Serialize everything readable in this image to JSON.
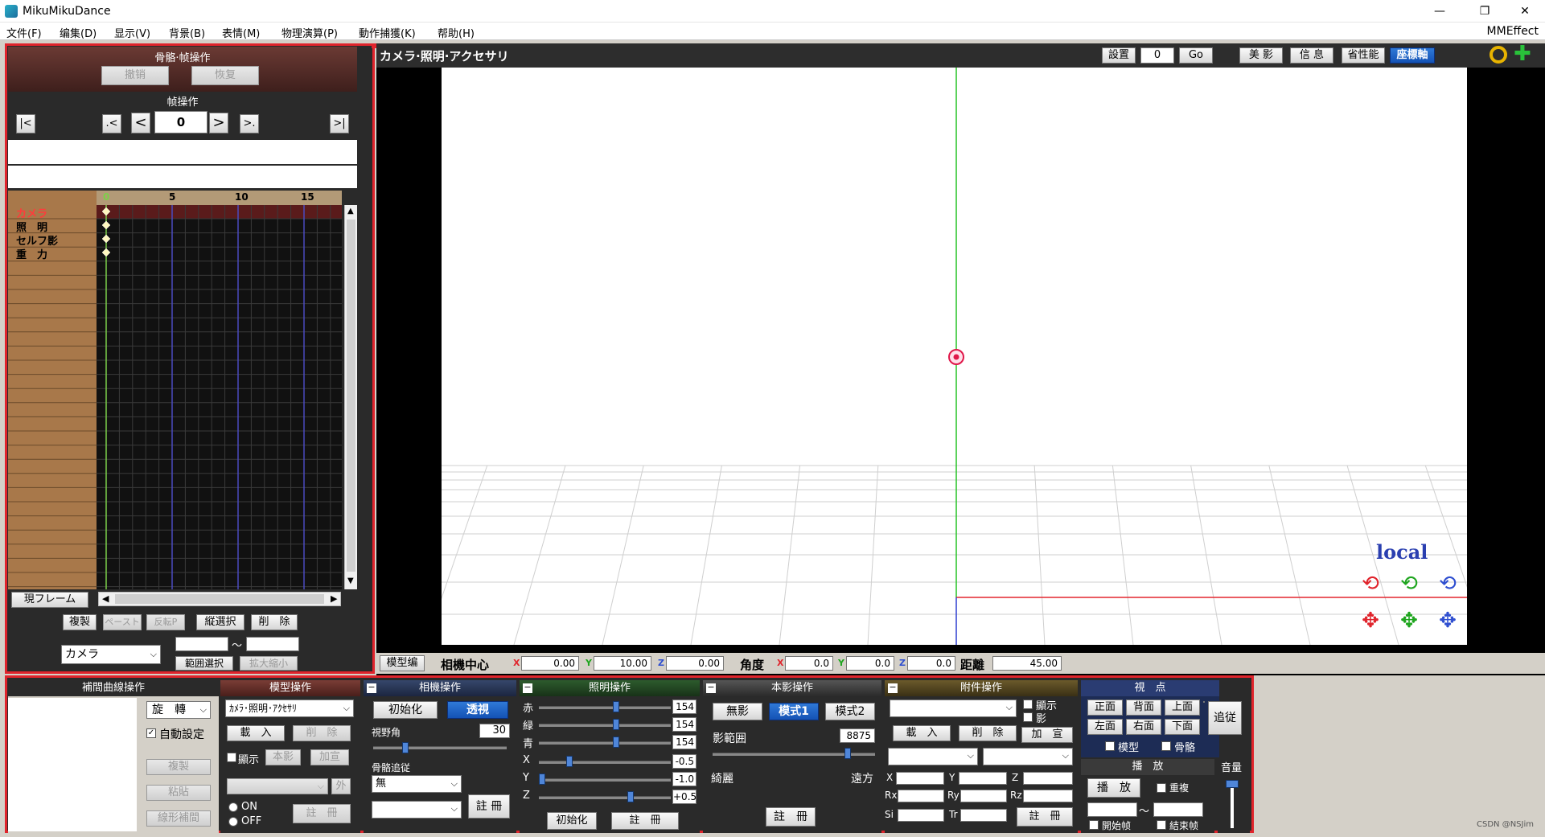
{
  "titlebar": {
    "title": "MikuMikuDance",
    "minimize": "—",
    "restore": "❐",
    "close": "✕"
  },
  "menu": [
    {
      "label": "文件(F)"
    },
    {
      "label": "编集(D)"
    },
    {
      "label": "显示(V)"
    },
    {
      "label": "背景(B)"
    },
    {
      "label": "表情(M)"
    },
    {
      "label": "物理演算(P)"
    },
    {
      "label": "動作捕獲(K)"
    },
    {
      "label": "帮助(H)"
    }
  ],
  "mmeffect": "MMEffect",
  "left": {
    "bone_frame_title": "骨骼·帧操作",
    "undo": "撤销",
    "redo": "恢复",
    "frame_op_title": "帧操作",
    "nav": {
      "first": "|<",
      "prev_key": ".<",
      "prev": "<",
      "frame": "0",
      "next": ">",
      "next_key": ">.",
      "last": ">|"
    },
    "ruler": [
      "0",
      "5",
      "10",
      "15"
    ],
    "tracks": [
      "カメラ",
      "照　明",
      "セルフ影",
      "重　力"
    ],
    "current_frame": "現フレーム",
    "buttons": {
      "copy": "複製",
      "paste": "ペースト",
      "reverse": "反転P",
      "vselect": "縦選択",
      "delete": "削　除"
    },
    "target_select": "カメラ",
    "range_select": "範囲選択",
    "scale": "拡大縮小",
    "tilde": "～"
  },
  "view": {
    "title": "カメラ·照明·アクセサリ",
    "setup": "設置",
    "frame_val": "0",
    "go": "Go",
    "beauty": "美 影",
    "info": "信 息",
    "perf": "省性能",
    "axis": "座標軸",
    "local": "local",
    "status": {
      "model_edit": "模型编",
      "center": "相機中心",
      "x": "0.00",
      "y": "10.00",
      "z": "0.00",
      "angle": "角度",
      "ax": "0.0",
      "ay": "0.0",
      "az": "0.0",
      "distance": "距離",
      "dist_val": "45.00",
      "xl": "X",
      "yl": "Y",
      "zl": "Z"
    }
  },
  "interp": {
    "title": "補間曲線操作",
    "rotate": "旋　轉",
    "auto": "自動設定",
    "copy": "複製",
    "paste": "粘貼",
    "linear": "線形補間"
  },
  "model": {
    "title": "模型操作",
    "select": "ｶﾒﾗ･照明･ｱｸｾｻﾘ",
    "load": "載　入",
    "delete": "削　除",
    "show": "顯示",
    "shadow": "本影",
    "add": "加宣",
    "out": "外",
    "on": "ON",
    "off": "OFF",
    "register": "註　冊"
  },
  "camera": {
    "title": "相機操作",
    "init": "初始化",
    "persp": "透視",
    "fov_label": "視野角",
    "fov": "30",
    "bone_follow": "骨骼追従",
    "follow_val": "無",
    "register": "註 冊"
  },
  "light": {
    "title": "照明操作",
    "r_label": "赤",
    "g_label": "緑",
    "b_label": "青",
    "r": "154",
    "g": "154",
    "b": "154",
    "x_label": "X",
    "y_label": "Y",
    "z_label": "Z",
    "x": "-0.5",
    "y": "-1.0",
    "z": "+0.5",
    "init": "初始化",
    "register": "註　冊"
  },
  "shadow": {
    "title": "本影操作",
    "none": "無影",
    "mode1": "模式1",
    "mode2": "模式2",
    "range_label": "影範囲",
    "range": "8875",
    "near": "綺麗",
    "far": "遠方",
    "register": "註　冊"
  },
  "accessory": {
    "title": "附件操作",
    "show": "顯示",
    "shadow": "影",
    "load": "載　入",
    "delete": "削　除",
    "add": "加　宣",
    "x": "X",
    "y": "Y",
    "z": "Z",
    "rx": "Rx",
    "ry": "Ry",
    "rz": "Rz",
    "si": "Si",
    "tr": "Tr",
    "register": "註　冊"
  },
  "viewpoint": {
    "title": "視　点",
    "front": "正面",
    "back": "背面",
    "top": "上面",
    "left": "左面",
    "right": "右面",
    "bottom": "下面",
    "follow": "追従",
    "model": "模型",
    "bone": "骨骼"
  },
  "play": {
    "title": "播　放",
    "play": "播　放",
    "repeat": "重複",
    "start": "開始帧",
    "end": "結束帧",
    "tilde": "～"
  },
  "volume": {
    "title": "音量"
  },
  "watermark": "CSDN @NSJim"
}
